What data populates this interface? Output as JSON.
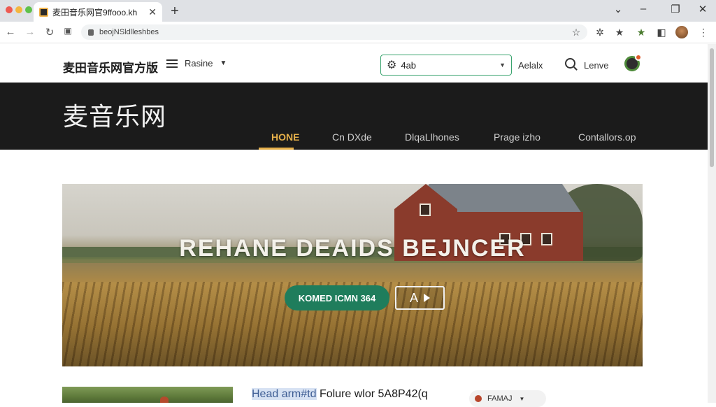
{
  "browser": {
    "tab_title": "麦田音乐网官9ffooo.kh",
    "url": "beojNSldlleshbes",
    "tab_close_glyph": "✕",
    "new_tab_glyph": "+",
    "traffic_lights": [
      "#ee5a52",
      "#f4b63f",
      "#5ec14a"
    ]
  },
  "header": {
    "brand": "麦田音乐网官方版",
    "menu_label": "Rasine",
    "select_value": "4ab",
    "links": [
      "Aelalx",
      "Lenve"
    ]
  },
  "band": {
    "title": "麦音乐网",
    "nav": [
      "HONE",
      "Cn DXde",
      "DlqaLlhones",
      "Prage izho",
      "Contallors.op"
    ],
    "accent": "#e6b04a"
  },
  "hero": {
    "title": "REHANE DEAIDS BEJNCER",
    "primary_button": "KOMED ICMN 364",
    "secondary_button": "A"
  },
  "article": {
    "title_highlight": "Head arm#td",
    "title_rest": " Folure wlor 5A8P42(q",
    "pill_label": "FAMAJ"
  }
}
